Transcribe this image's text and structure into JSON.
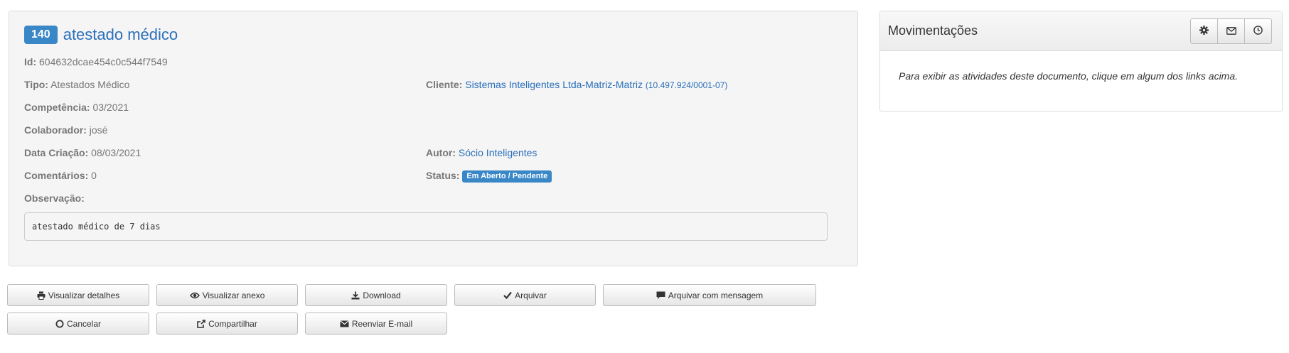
{
  "document": {
    "number": "140",
    "title": "atestado médico",
    "id_label": "Id:",
    "id_value": "604632dcae454c0c544f7549",
    "tipo_label": "Tipo:",
    "tipo_value": "Atestados Médico",
    "cliente_label": "Cliente:",
    "cliente_value": "Sistemas Inteligentes Ltda-Matriz-Matriz",
    "cliente_cnpj": "(10.497.924/0001-07)",
    "competencia_label": "Competência:",
    "competencia_value": "03/2021",
    "colaborador_label": "Colaborador:",
    "colaborador_value": "josé",
    "data_criacao_label": "Data Criação:",
    "data_criacao_value": "08/03/2021",
    "autor_label": "Autor:",
    "autor_value": "Sócio Inteligentes",
    "comentarios_label": "Comentários:",
    "comentarios_value": "0",
    "status_label": "Status:",
    "status_value": "Em Aberto / Pendente",
    "observacao_label": "Observação:",
    "observacao_text": "atestado médico de 7 dias"
  },
  "actions": {
    "visualizar_detalhes": "Visualizar detalhes",
    "visualizar_anexo": "Visualizar anexo",
    "download": "Download",
    "arquivar": "Arquivar",
    "arquivar_com_mensagem": "Arquivar com mensagem",
    "cancelar": "Cancelar",
    "compartilhar": "Compartilhar",
    "reenviar_email": "Reenviar E-mail"
  },
  "movimentacoes": {
    "title": "Movimentações",
    "buttons": [
      "gear-icon",
      "envelope-icon",
      "clock-icon"
    ],
    "hint": "Para exibir as atividades deste documento, clique em algum dos links acima."
  },
  "colors": {
    "accent": "#3a87c8",
    "link": "#2a6fba",
    "panel_bg": "#f5f5f5"
  }
}
